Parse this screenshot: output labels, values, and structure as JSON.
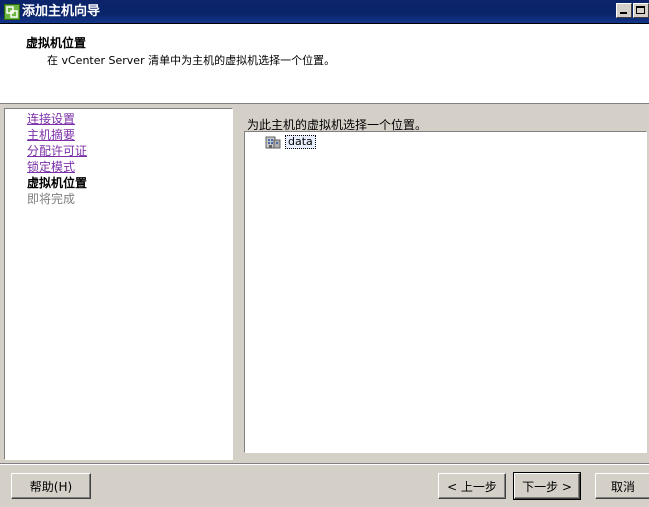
{
  "window": {
    "title": "添加主机向导",
    "icon": "vsphere-icon",
    "controls": [
      "minimize-icon",
      "maximize-icon"
    ]
  },
  "header": {
    "title": "虚拟机位置",
    "subtitle": "在 vCenter Server 清单中为主机的虚拟机选择一个位置。"
  },
  "nav": {
    "items": [
      {
        "label": "连接设置",
        "state": "visited"
      },
      {
        "label": "主机摘要",
        "state": "visited"
      },
      {
        "label": "分配许可证",
        "state": "visited"
      },
      {
        "label": "锁定模式",
        "state": "visited"
      },
      {
        "label": "虚拟机位置",
        "state": "current"
      },
      {
        "label": "即将完成",
        "state": "disabled"
      }
    ]
  },
  "main": {
    "prompt": "为此主机的虚拟机选择一个位置。",
    "tree": [
      {
        "label": "data",
        "icon": "datacenter-icon",
        "selected": true
      }
    ]
  },
  "buttons": {
    "help": "帮助(H)",
    "back": "< 上一步",
    "next": "下一步 >",
    "cancel": "取消"
  },
  "colors": {
    "titlebar": "#0a246a",
    "visited_link": "#7b2fa8",
    "disabled_text": "#808080",
    "face": "#d4d0c8"
  }
}
